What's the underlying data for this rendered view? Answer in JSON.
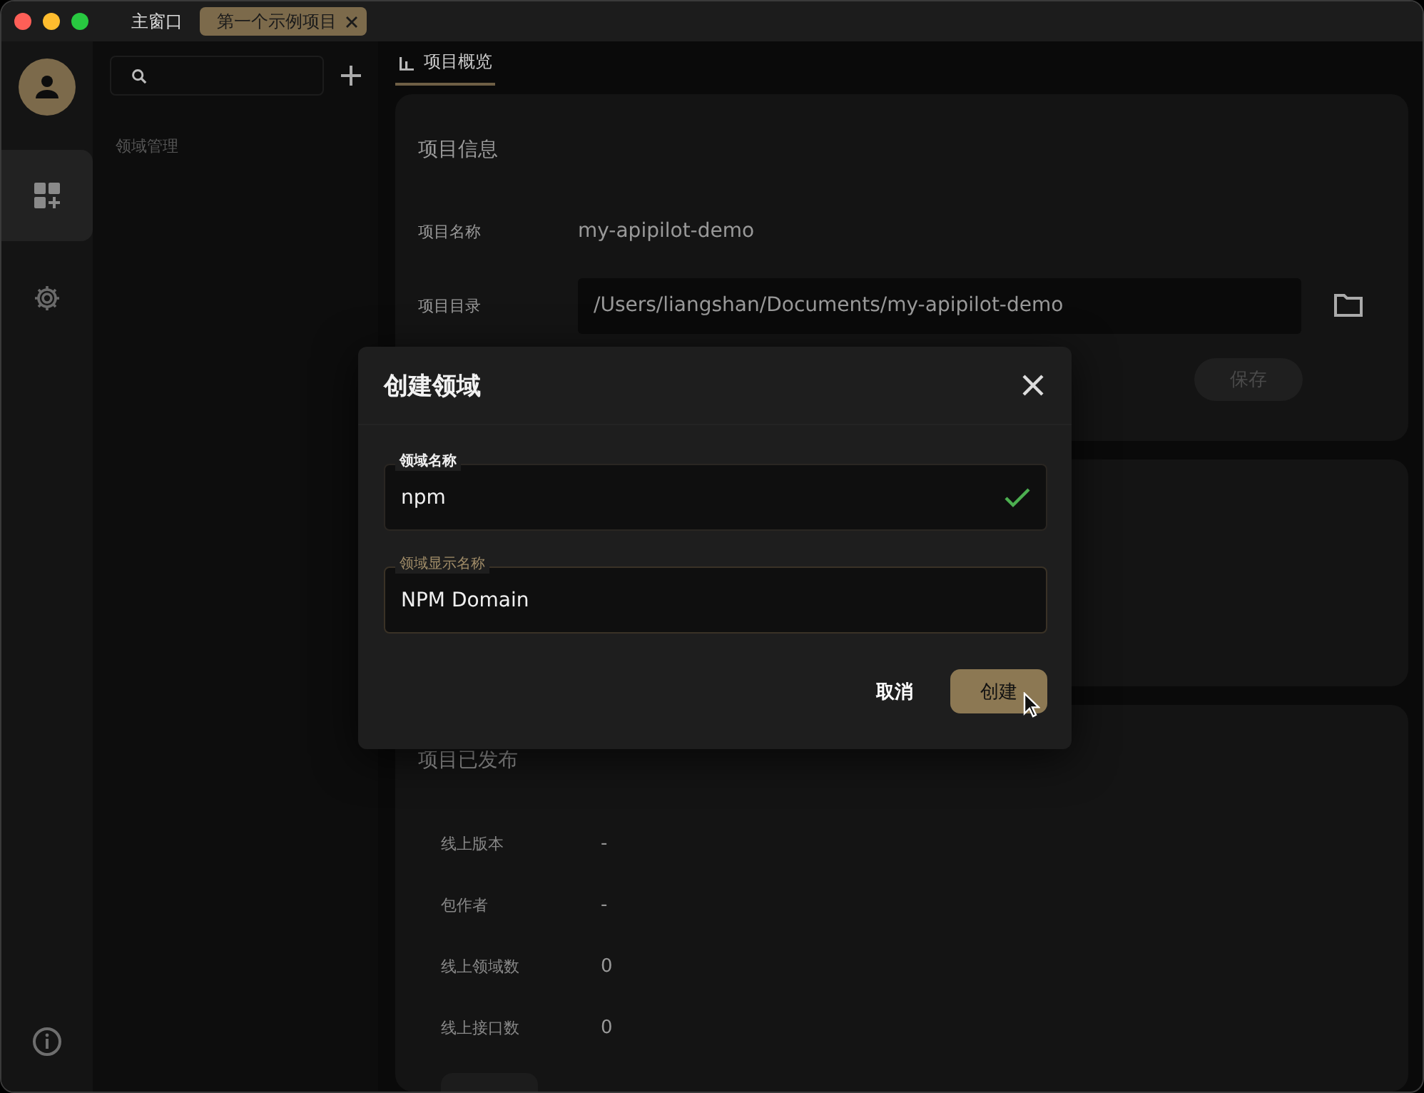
{
  "window": {
    "tabs": [
      {
        "label": "主窗口",
        "selected": false,
        "closable": false
      },
      {
        "label": "第一个示例项目",
        "selected": true,
        "closable": true
      }
    ]
  },
  "rail": {
    "items": [
      {
        "selected": true
      },
      {
        "selected": false
      }
    ]
  },
  "sidebar": {
    "section_label": "领域管理"
  },
  "main": {
    "tabs": [
      {
        "label": "项目概览",
        "selected": true
      }
    ],
    "info_card": {
      "title": "项目信息",
      "rows": [
        {
          "label": "项目名称",
          "kind": "text",
          "value": "my-apipilot-demo"
        },
        {
          "label": "项目目录",
          "kind": "path",
          "value": "/Users/liangshan/Documents/my-apipilot-demo"
        }
      ],
      "save_button": {
        "label": "保存",
        "disabled": true
      }
    },
    "publish_card": {
      "title": "项目已发布",
      "rows": [
        {
          "label": "线上版本",
          "value": "-"
        },
        {
          "label": "包作者",
          "value": "-"
        },
        {
          "label": "线上领域数",
          "value": "0"
        },
        {
          "label": "线上接口数",
          "value": "0"
        }
      ]
    }
  },
  "dialog": {
    "title": "创建领域",
    "fields": [
      {
        "label": "领域名称",
        "value": "npm",
        "valid": true,
        "focused": false
      },
      {
        "label": "领域显示名称",
        "value": "NPM Domain",
        "valid": false,
        "focused": true
      }
    ],
    "buttons": [
      {
        "label": "取消",
        "kind": "text"
      },
      {
        "label": "创建",
        "kind": "primary"
      }
    ]
  }
}
